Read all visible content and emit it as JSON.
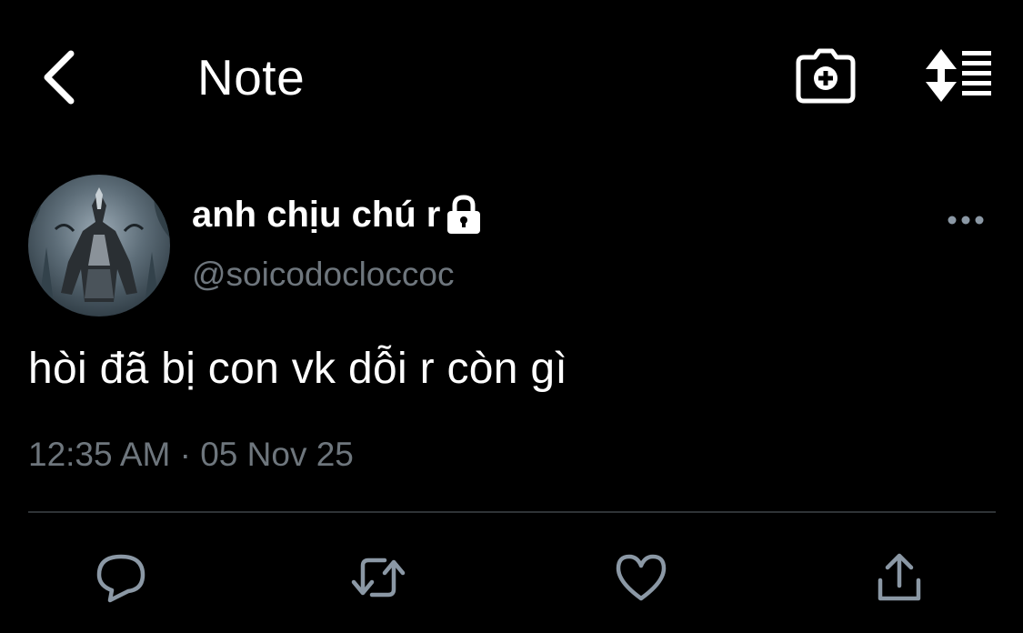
{
  "header": {
    "back_icon": "chevron-left-icon",
    "title": "Note",
    "camera_icon": "camera-add-icon",
    "sort_icon": "sort-list-icon"
  },
  "tweet": {
    "display_name": "anh chịu chú r",
    "protected_icon": "lock-icon",
    "handle": "@soicodocloccoc",
    "more_icon": "more-horizontal-icon",
    "text": "hòi đã bị con vk dỗi r còn gì",
    "timestamp": "12:35 AM · 05 Nov 25",
    "avatar": "werewolf-avatar"
  },
  "actions": [
    {
      "icon": "reply-icon"
    },
    {
      "icon": "retweet-icon"
    },
    {
      "icon": "like-icon"
    },
    {
      "icon": "share-icon"
    }
  ],
  "colors": {
    "background": "#000000",
    "text": "#ffffff",
    "secondary_text": "#6e767d",
    "divider": "#2f3336"
  }
}
